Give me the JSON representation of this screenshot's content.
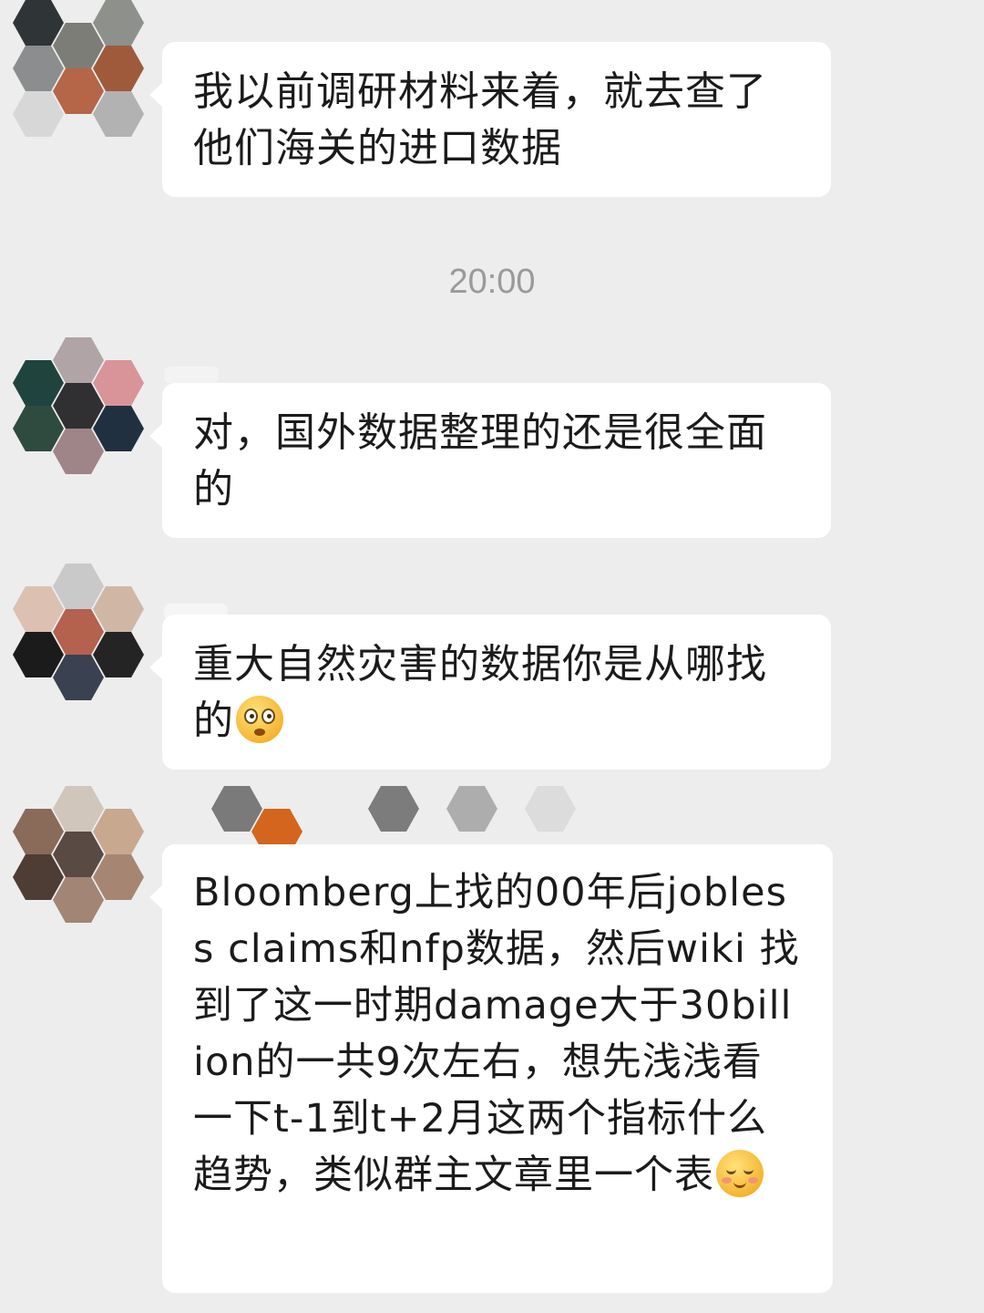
{
  "chat": {
    "timestamp": "20:00",
    "messages": [
      {
        "text": "我以前调研材料来着，就去查了他们海关的进口数据",
        "emoji": "",
        "avatar_colors": [
          "#2f3436",
          "#7c7d76",
          "#8e908c",
          "#9f5a3c",
          "#b56548",
          "#8b8d8f",
          "#c0c1c3",
          "#d7d7d7",
          "#b2b2b2"
        ]
      },
      {
        "text": "对，国外数据整理的还是很全面的",
        "emoji": "",
        "avatar_colors": [
          "#b1a4a6",
          "#20443d",
          "#d9949a",
          "#303033",
          "#213040",
          "#7c6c68",
          "#9f8488",
          "#3b3d3e",
          "#cfcfcf"
        ]
      },
      {
        "text": "重大自然灾害的数据你是从哪找的",
        "emoji": "astonished-face",
        "avatar_colors": [
          "#c9c9c9",
          "#c9b3a6",
          "#e0c9bd",
          "#b4614e",
          "#d0b7a5",
          "#1b1b1b",
          "#242424",
          "#3a4150",
          "#cfcfcf"
        ]
      },
      {
        "text": "Bloomberg上找的00年后jobless claims和nfp数据，然后wiki 找到了这一时期damage大于30billion的一共9次左右，想先浅浅看一下t-1到t+2月这两个指标什么趋势，类似群主文章里一个表",
        "emoji": "blushing-smile-face",
        "avatar_colors": [
          "#d1c6bb",
          "#8a6a58",
          "#c9a890",
          "#5a4a44",
          "#8d7f78",
          "#4d3d34",
          "#a68673",
          "#a38575",
          "#9c7c6d"
        ]
      }
    ],
    "name_placeholders": [
      {
        "shapes": [
          "#7a7a7a",
          "#d4651e",
          "#7c7c7c",
          "#adadad",
          "#dcdcdc"
        ]
      }
    ]
  }
}
